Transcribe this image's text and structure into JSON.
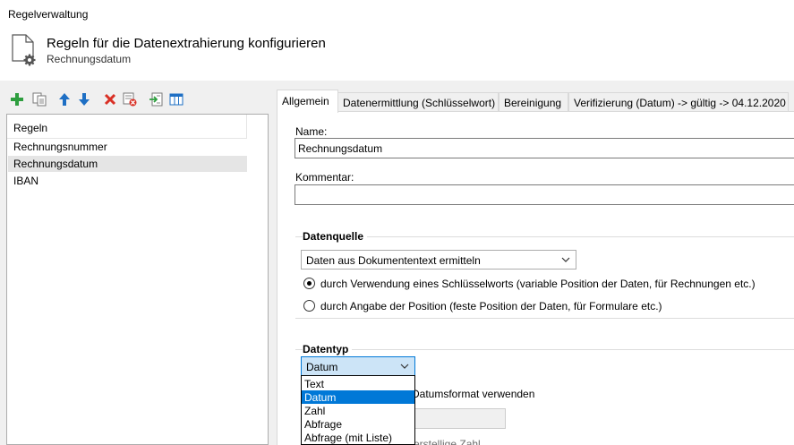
{
  "window": {
    "title": "Regelverwaltung"
  },
  "header": {
    "title": "Regeln für die Datenextrahierung konfigurieren",
    "subtitle": "Rechnungsdatum"
  },
  "toolbar": {
    "icons": [
      "add-icon",
      "copy-icon",
      "move-up-icon",
      "move-down-icon",
      "delete-icon",
      "delete-all-icon",
      "import-icon",
      "columns-icon"
    ]
  },
  "rules": {
    "header": "Regeln",
    "items": [
      {
        "label": "Rechnungsnummer",
        "selected": false
      },
      {
        "label": "Rechnungsdatum",
        "selected": true
      },
      {
        "label": "IBAN",
        "selected": false
      }
    ]
  },
  "tabs": [
    {
      "label": "Allgemein",
      "active": true
    },
    {
      "label": "Datenermittlung (Schlüsselwort)",
      "active": false
    },
    {
      "label": "Bereinigung",
      "active": false
    },
    {
      "label": "Verifizierung (Datum) -> gültig -> 04.12.2020",
      "active": false
    }
  ],
  "form": {
    "name_label": "Name:",
    "name_value": "Rechnungsdatum",
    "comment_label": "Kommentar:",
    "comment_value": "",
    "datasource": {
      "title": "Datenquelle",
      "selected": "Daten aus Dokumententext ermitteln",
      "radio_keyword": "durch Verwendung eines Schlüsselworts (variable Position der Daten, für Rechnungen etc.)",
      "radio_position": "durch Angabe der Position (feste Position der Daten, für Formulare etc.)",
      "keyword_checked": true
    },
    "datatype": {
      "title": "Datentyp",
      "selected": "Datum",
      "options": [
        "Text",
        "Datum",
        "Zahl",
        "Abfrage",
        "Abfrage (mit Liste)"
      ],
      "behind_label_1": "Datumsformat verwenden",
      "behind_label_2": "erstellige Zahl"
    }
  },
  "colors": {
    "accent": "#0078d7",
    "selection": "#cce4f7",
    "add_green": "#2e9e3f",
    "delete_red": "#d93025",
    "arrow_blue": "#1e6fc4"
  }
}
